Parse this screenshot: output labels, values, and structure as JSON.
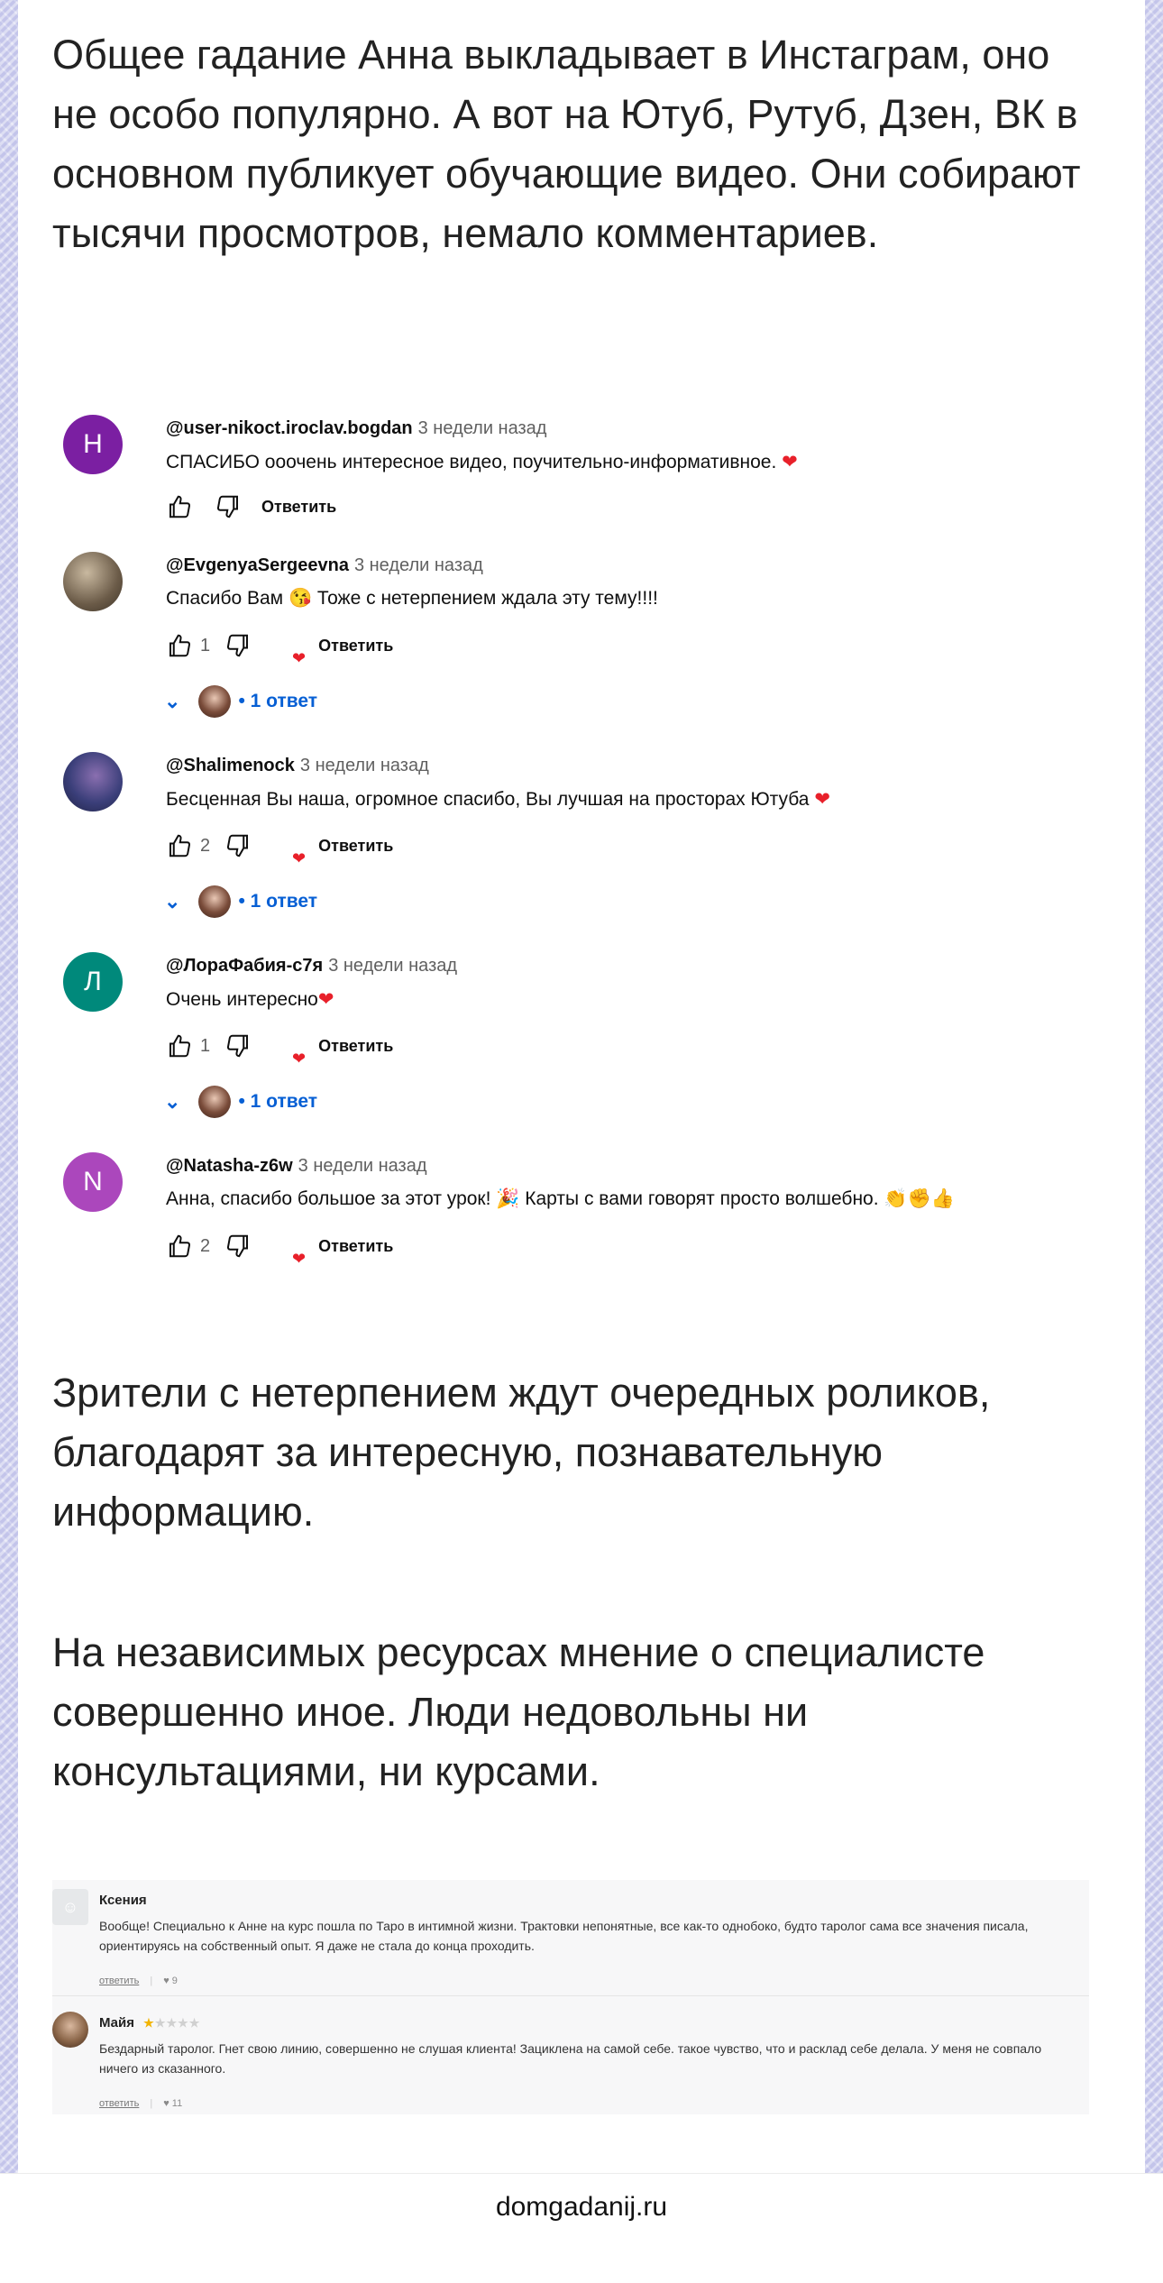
{
  "intro_text": "Общее гадание Анна выкладывает в Инстаграм, оно не особо популярно. А вот на Ютуб, Рутуб, Дзен, ВК в основном публикует обучающие видео. Они собирают тысячи просмотров, немало комментариев.",
  "youtube_comments": {
    "reply_label": "Ответить",
    "replies_label": "• 1 ответ",
    "items": [
      {
        "avatar_letter": "Н",
        "avatar_color": "#7b1fa2",
        "handle": "@user-nikoct.iroclav.bogdan",
        "ago": "3 недели назад",
        "text": "СПАСИБО  ооочень интересное видео, поучительно-информативное. ",
        "emoji": "❤",
        "likes": ""
      },
      {
        "avatar_letter": "",
        "handle": "@EvgenyaSergeevna",
        "ago": "3 недели назад",
        "text": "Спасибо Вам 😘  Тоже с нетерпением ждала эту тему!!!!",
        "emoji": "",
        "likes": "1"
      },
      {
        "avatar_letter": "",
        "handle": "@Shalimenock",
        "ago": "3 недели назад",
        "text": "Бесценная Вы наша, огромное спасибо, Вы лучшая на просторах Ютуба ",
        "emoji": "❤",
        "likes": "2"
      },
      {
        "avatar_letter": "Л",
        "avatar_color": "#00897b",
        "handle": "@ЛораФабия-с7я",
        "ago": "3 недели назад",
        "text": "Очень интересно",
        "emoji": "❤",
        "likes": "1"
      },
      {
        "avatar_letter": "N",
        "avatar_color": "#ab47bc",
        "handle": "@Natasha-z6w",
        "ago": "3 недели назад",
        "text": "Анна, спасибо большое за этот урок! 🎉 Карты с вами говорят просто волшебно. 👏✊👍",
        "emoji": "",
        "likes": "2"
      }
    ]
  },
  "middle_text": "Зрители с нетерпением ждут очередных роликов, благодарят за интересную, познавательную информацию.",
  "lower_text": "На независимых ресурсах мнение о специалисте совершенно иное. Люди недовольны ни консультациями, ни курсами.",
  "reviews": {
    "reply_label": "ответить",
    "items": [
      {
        "name": "Ксения",
        "stars": "",
        "text": "Вообще! Специально к Анне на курс пошла по Таро в интимной жизни. Трактовки непонятные, все как-то однобоко, будто таролог сама все значения писала, ориентируясь на собственный опыт. Я даже не стала до конца проходить.",
        "likes": "9"
      },
      {
        "name": "Майя",
        "stars_on": "★",
        "stars_off": "★★★★",
        "text": "Бездарный таролог. Гнет свою линию, совершенно не слушая клиента! Зациклена на самой себе. такое чувство, что и расклад себе делала. У меня не совпало ничего из сказанного.",
        "likes": "11"
      }
    ]
  },
  "footer": {
    "site": "domgadanij.ru"
  }
}
